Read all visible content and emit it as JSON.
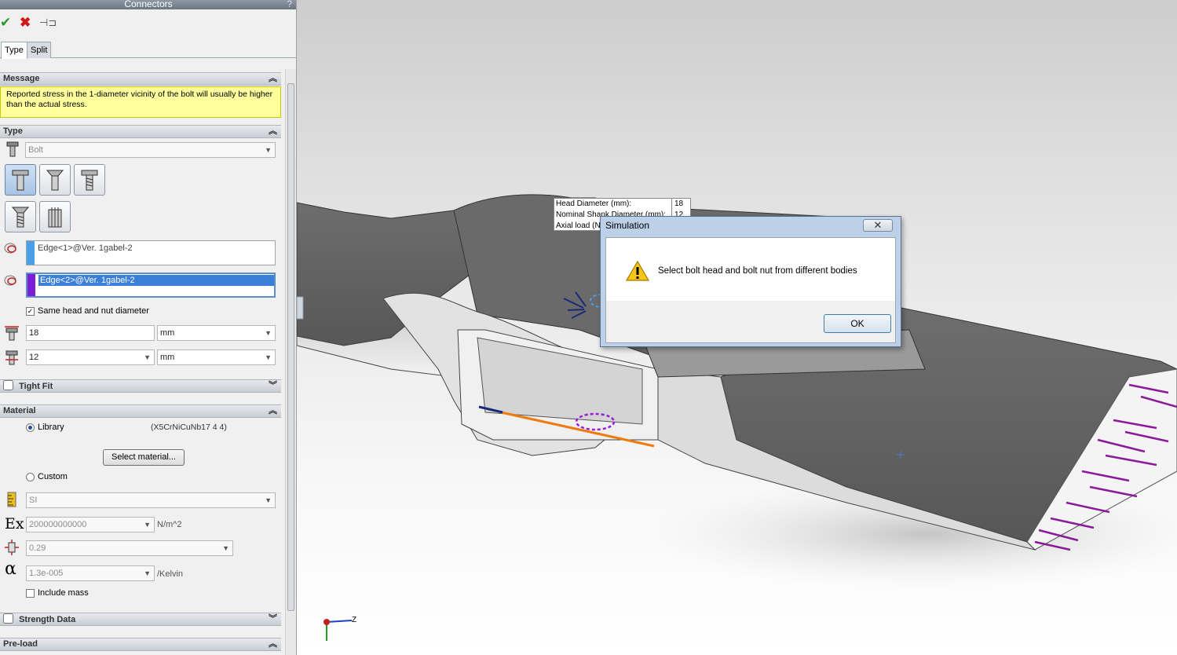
{
  "panel": {
    "title": "Connectors",
    "help": "?",
    "tabs": [
      {
        "label": "Type"
      },
      {
        "label": "Split"
      }
    ],
    "message": {
      "header": "Message",
      "text": "Reported stress in the 1-diameter vicinity of the bolt will usually be higher than the actual stress."
    },
    "type": {
      "header": "Type",
      "selected": "Bolt",
      "edge1": "Edge<1>@Ver. 1gabel-2",
      "edge2": "Edge<2>@Ver. 1gabel-2",
      "same_diameter_label": "Same head and nut diameter",
      "head_diameter": "18",
      "head_unit": "mm",
      "shank_diameter": "12",
      "shank_unit": "mm"
    },
    "tight_fit": {
      "header": "Tight Fit"
    },
    "material": {
      "header": "Material",
      "library_label": "Library",
      "library_value": "(X5CrNiCuNb17 4 4)",
      "select_button": "Select material...",
      "custom_label": "Custom",
      "units": "SI",
      "ex_symbol": "Ex",
      "ex_value": "200000000000",
      "ex_unit": "N/m^2",
      "nu_value": "0.29",
      "alpha_symbol": "α",
      "alpha_value": "1.3e-005",
      "alpha_unit": "/Kelvin",
      "include_mass_label": "Include mass"
    },
    "strength_data": {
      "header": "Strength Data"
    },
    "preload": {
      "header": "Pre-load"
    }
  },
  "tooltip": {
    "rows": [
      {
        "label": "Head Diameter (mm):",
        "value": "18"
      },
      {
        "label": "Nominal Shank Diameter (mm):",
        "value": "12"
      },
      {
        "label": "Axial load (N):",
        "value": ""
      }
    ]
  },
  "dialog": {
    "title": "Simulation",
    "message": "Select bolt head and bolt nut from different bodies",
    "ok": "OK"
  },
  "triad": {
    "label": "Z"
  },
  "colors": {
    "accent": "#1a4ea2",
    "edge1": "#4a9fe8",
    "edge2": "#7a1fd6",
    "load_arrows": "#8a1a9a",
    "bolt_line": "#f07a10"
  }
}
